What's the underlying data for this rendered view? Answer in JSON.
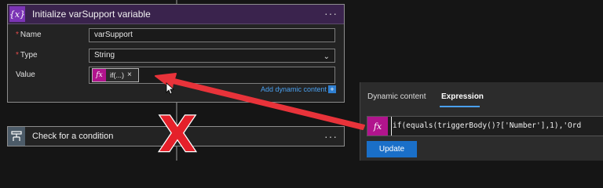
{
  "variable_card": {
    "icon": "variable-braces-icon",
    "icon_glyph": "{x}",
    "title": "Initialize varSupport variable",
    "menu_glyph": "···",
    "name_label": "Name",
    "name_value": "varSupport",
    "type_label": "Type",
    "type_value": "String",
    "value_label": "Value",
    "token_glyph": "fx",
    "token_label": "if(...)",
    "token_remove": "×",
    "add_dynamic_label": "Add dynamic content",
    "add_dynamic_plus": "+"
  },
  "condition_card": {
    "icon": "condition-icon",
    "title": "Check for a condition",
    "menu_glyph": "···"
  },
  "expression_panel": {
    "tabs": [
      {
        "label": "Dynamic content",
        "active": false
      },
      {
        "label": "Expression",
        "active": true
      }
    ],
    "fx_glyph": "fx",
    "expression_value": "if(equals(triggerBody()?['Number'],1),'Ord",
    "update_label": "Update"
  },
  "annotation": {
    "cross_glyph": "X",
    "arrow_color": "#e8333a",
    "cross_color": "#e5202a"
  },
  "colors": {
    "header_purple": "#3a234d",
    "variable_icon": "#7b34b5",
    "fx_magenta": "#b1148d",
    "accent_blue": "#1a6fc8"
  }
}
